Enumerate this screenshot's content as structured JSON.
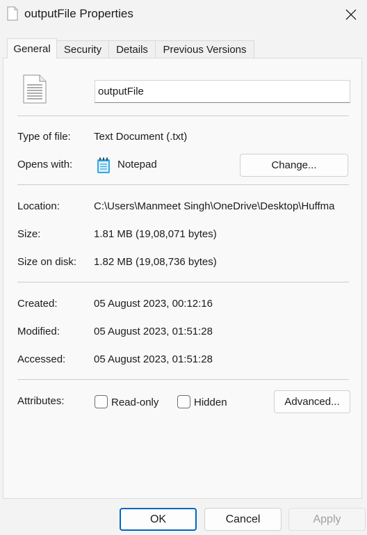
{
  "window": {
    "title": "outputFile Properties"
  },
  "icons": {
    "title": "document-icon",
    "close": "close-icon",
    "file": "text-file-icon",
    "opens_with": "notepad-icon"
  },
  "tabs": [
    {
      "label": "General",
      "active": true
    },
    {
      "label": "Security",
      "active": false
    },
    {
      "label": "Details",
      "active": false
    },
    {
      "label": "Previous Versions",
      "active": false
    }
  ],
  "general": {
    "file_name": "outputFile",
    "type_of_file": {
      "label": "Type of file:",
      "value": "Text Document (.txt)"
    },
    "opens_with": {
      "label": "Opens with:",
      "value": "Notepad",
      "change_label": "Change..."
    },
    "location": {
      "label": "Location:",
      "value": "C:\\Users\\Manmeet Singh\\OneDrive\\Desktop\\Huffma"
    },
    "size": {
      "label": "Size:",
      "value": "1.81 MB (19,08,071 bytes)"
    },
    "size_on_disk": {
      "label": "Size on disk:",
      "value": "1.82 MB (19,08,736 bytes)"
    },
    "created": {
      "label": "Created:",
      "value": "05 August 2023, 00:12:16"
    },
    "modified": {
      "label": "Modified:",
      "value": "05 August 2023, 01:51:28"
    },
    "accessed": {
      "label": "Accessed:",
      "value": "05 August 2023, 01:51:28"
    },
    "attributes": {
      "label": "Attributes:",
      "read_only": {
        "label": "Read-only",
        "checked": false
      },
      "hidden": {
        "label": "Hidden",
        "checked": false
      },
      "advanced_label": "Advanced..."
    }
  },
  "footer": {
    "ok": "OK",
    "cancel": "Cancel",
    "apply": "Apply",
    "apply_enabled": false
  },
  "colors": {
    "accent": "#0067c0",
    "disabled_text": "#a0a0a0",
    "notepad": "#37a6e0"
  }
}
